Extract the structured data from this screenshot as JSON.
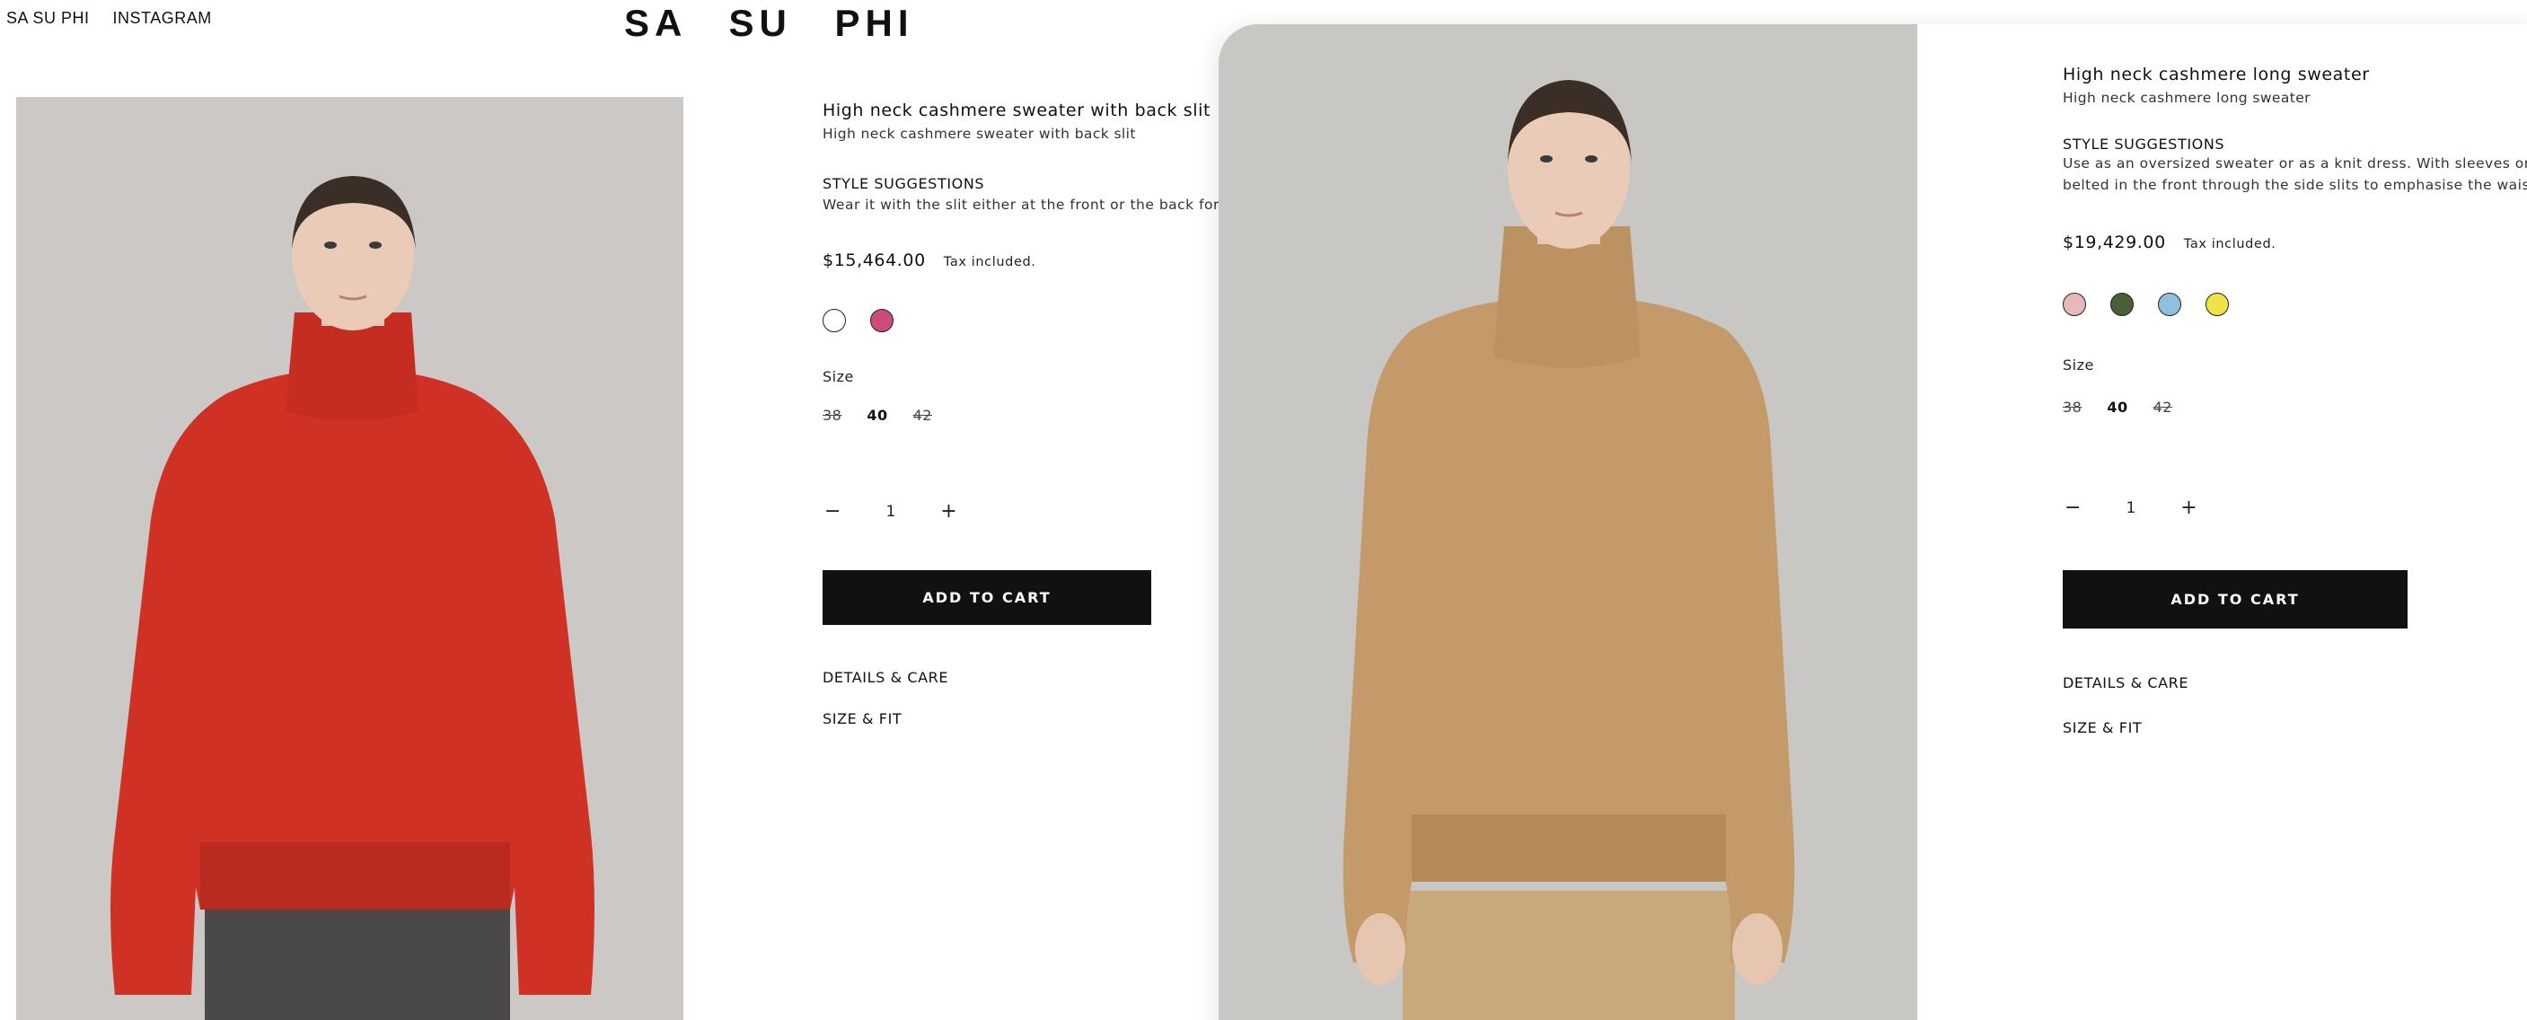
{
  "nav": {
    "items": [
      "SA SU PHI",
      "INSTAGRAM"
    ]
  },
  "brand": "SA SU PHI",
  "left_product": {
    "title": "High neck cashmere sweater with back slit",
    "subtitle": "High neck cashmere sweater with back slit",
    "style_heading": "STYLE SUGGESTIONS",
    "style_text": "Wear it with the slit either at the front or the back for ver",
    "price": "$15,464.00",
    "tax": "Tax included.",
    "swatch_colors": [
      "#ffffff",
      "#cc4a7c"
    ],
    "size_label": "Size",
    "sizes": [
      {
        "label": "38",
        "available": false
      },
      {
        "label": "40",
        "available": true
      },
      {
        "label": "42",
        "available": false
      }
    ],
    "qty": {
      "minus": "−",
      "value": "1",
      "plus": "+"
    },
    "add_to_cart": "ADD TO CART",
    "details": "DETAILS & CARE",
    "size_fit": "SIZE & FIT",
    "sweater_color": "#cf3225"
  },
  "right_product": {
    "title": "High neck cashmere long sweater",
    "subtitle": "High neck cashmere long sweater",
    "style_heading": "STYLE SUGGESTIONS",
    "style_text_1": "Use as an oversized sweater or as a knit dress. With sleeves or",
    "style_text_2": "belted in the front through the side slits to emphasise the waist.",
    "price": "$19,429.00",
    "tax": "Tax included.",
    "swatch_colors": [
      "#e6b8b6",
      "#4a5e38",
      "#8fc0de",
      "#f2e24a"
    ],
    "size_label": "Size",
    "sizes": [
      {
        "label": "38",
        "available": false
      },
      {
        "label": "40",
        "available": true
      },
      {
        "label": "42",
        "available": false
      }
    ],
    "qty": {
      "minus": "−",
      "value": "1",
      "plus": "+"
    },
    "add_to_cart": "ADD TO CART",
    "details": "DETAILS & CARE",
    "size_fit": "SIZE & FIT",
    "sweater_color": "#c49a6b"
  }
}
